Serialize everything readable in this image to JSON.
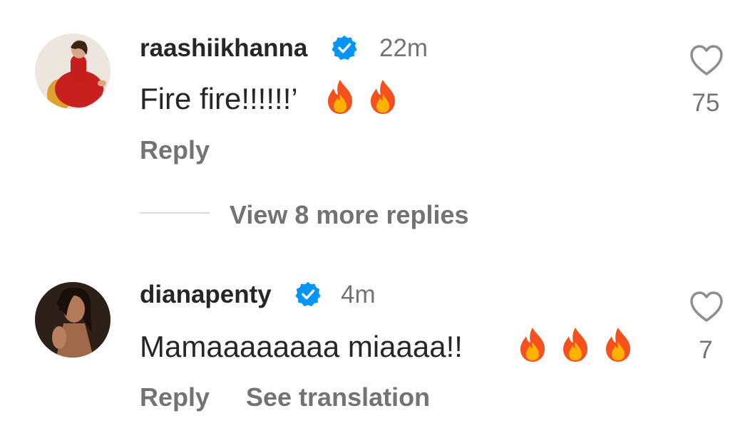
{
  "comments": [
    {
      "username": "raashiikhanna",
      "verified": true,
      "time": "22m",
      "text": "Fire fire!!!!!!’",
      "emoji_count": 2,
      "emoji_icon": "fire-icon",
      "likes": "75",
      "reply_label": "Reply"
    },
    {
      "username": "dianapenty",
      "verified": true,
      "time": "4m",
      "text": "Mamaaaaaaaa miaaaa!!",
      "emoji_count": 3,
      "emoji_icon": "fire-icon",
      "likes": "7",
      "reply_label": "Reply",
      "translate_label": "See translation"
    }
  ],
  "view_replies_label": "View 8 more replies",
  "colors": {
    "verified_blue": "#0095f6",
    "secondary_text": "#737373",
    "primary_text": "#262626",
    "fire_outer": "#f4511e",
    "fire_inner": "#ffb300"
  }
}
